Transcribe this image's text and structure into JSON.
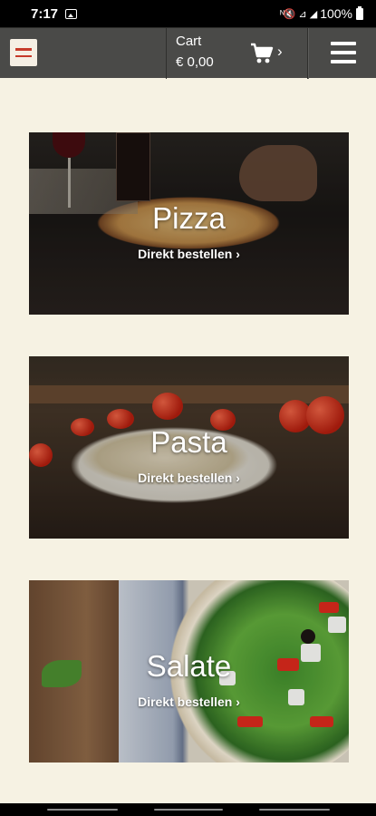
{
  "status_bar": {
    "time": "7:17",
    "battery": "100%",
    "icons": [
      "image-icon",
      "mute-icon",
      "wifi-icon",
      "signal-icon",
      "battery-icon"
    ]
  },
  "header": {
    "logo_alt": "restaurant-logo",
    "cart_label": "Cart",
    "cart_total": "€ 0,00",
    "cart_chevron": "›",
    "menu_icon": "hamburger-icon"
  },
  "categories": [
    {
      "title": "Pizza",
      "link": "Direkt bestellen ›"
    },
    {
      "title": "Pasta",
      "link": "Direkt bestellen ›"
    },
    {
      "title": "Salate",
      "link": "Direkt bestellen ›"
    }
  ],
  "colors": {
    "background": "#f6f2e3",
    "header": "#4a4a48",
    "status_bar": "#000000",
    "text_light": "#ffffff"
  }
}
